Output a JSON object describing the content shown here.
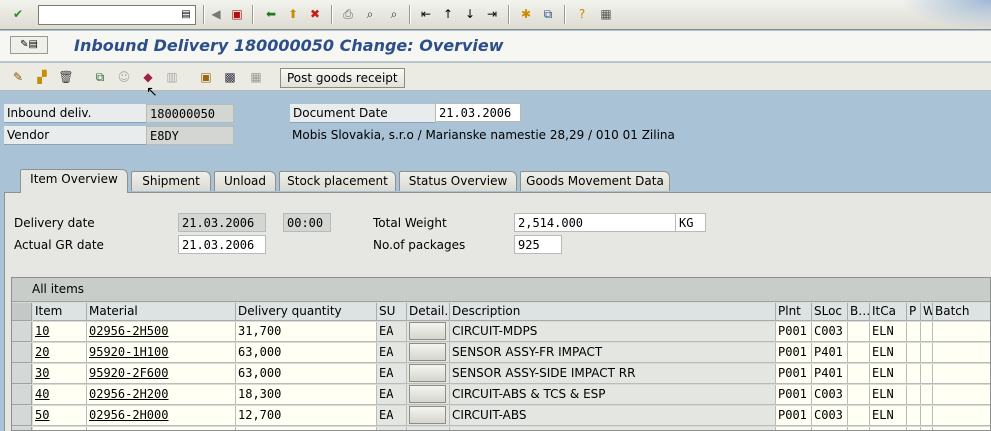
{
  "toolbar": {
    "command_value": "",
    "icons": [
      "enter-icon",
      "history-dropdown-icon",
      "back-arrow-icon",
      "save-icon",
      "back-icon",
      "exit-icon",
      "cancel-icon",
      "print-icon",
      "find-icon",
      "find-next-icon",
      "first-page-icon",
      "previous-page-icon",
      "next-page-icon",
      "last-page-icon",
      "new-session-icon",
      "shortcut-icon",
      "help-icon",
      "layout-icon"
    ]
  },
  "title": "Inbound Delivery 180000050 Change: Overview",
  "app_toolbar": {
    "post_goods_receipt": "Post goods receipt"
  },
  "header": {
    "inbound_label": "Inbound deliv.",
    "inbound_value": "180000050",
    "vendor_label": "Vendor",
    "vendor_value": "E8DY",
    "doc_date_label": "Document Date",
    "doc_date_value": "21.03.2006",
    "vendor_address": "Mobis Slovakia, s.r.o / Marianske namestie 28,29 / 010 01 Zilina"
  },
  "tabs": [
    {
      "label": "Item Overview",
      "active": true
    },
    {
      "label": "Shipment"
    },
    {
      "label": "Unload"
    },
    {
      "label": "Stock placement"
    },
    {
      "label": "Status Overview"
    },
    {
      "label": "Goods Movement Data"
    }
  ],
  "overview": {
    "delivery_date_label": "Delivery date",
    "delivery_date_value": "21.03.2006",
    "delivery_time_value": "00:00",
    "actual_gr_label": "Actual GR date",
    "actual_gr_value": "21.03.2006",
    "total_weight_label": "Total Weight",
    "total_weight_value": "2,514.000",
    "weight_unit": "KG",
    "packages_label": "No.of packages",
    "packages_value": "925"
  },
  "table": {
    "title": "All items",
    "columns": [
      "Item",
      "Material",
      "Delivery quantity",
      "SU",
      "Detail…",
      "Description",
      "Plnt",
      "SLoc",
      "B…",
      "ItCa",
      "P",
      "W",
      "Batch"
    ],
    "rows": [
      {
        "item": "10",
        "material": "02956-2H500",
        "qty": "31,700",
        "su": "EA",
        "desc": "CIRCUIT-MDPS",
        "plnt": "P001",
        "sloc": "C003",
        "itca": "ELN"
      },
      {
        "item": "20",
        "material": "95920-1H100",
        "qty": "63,000",
        "su": "EA",
        "desc": "SENSOR ASSY-FR IMPACT",
        "plnt": "P001",
        "sloc": "P401",
        "itca": "ELN"
      },
      {
        "item": "30",
        "material": "95920-2F600",
        "qty": "63,000",
        "su": "EA",
        "desc": "SENSOR ASSY-SIDE IMPACT RR",
        "plnt": "P001",
        "sloc": "P401",
        "itca": "ELN"
      },
      {
        "item": "40",
        "material": "02956-2H200",
        "qty": "18,300",
        "su": "EA",
        "desc": "CIRCUIT-ABS & TCS & ESP",
        "plnt": "P001",
        "sloc": "C003",
        "itca": "ELN"
      },
      {
        "item": "50",
        "material": "02956-2H000",
        "qty": "12,700",
        "su": "EA",
        "desc": "CIRCUIT-ABS",
        "plnt": "P001",
        "sloc": "C003",
        "itca": "ELN"
      }
    ]
  }
}
